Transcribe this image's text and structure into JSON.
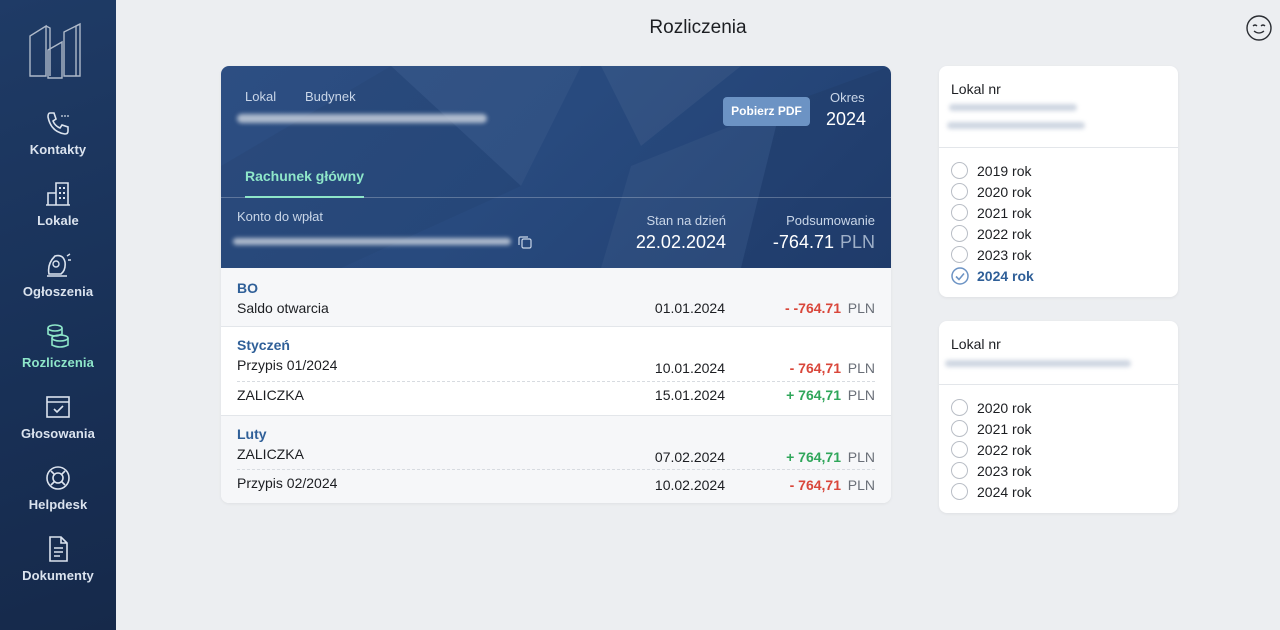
{
  "header": {
    "title": "Rozliczenia"
  },
  "sidebar": {
    "items": [
      {
        "label": "Kontakty"
      },
      {
        "label": "Lokale"
      },
      {
        "label": "Ogłoszenia"
      },
      {
        "label": "Rozliczenia",
        "active": true
      },
      {
        "label": "Głosowania"
      },
      {
        "label": "Helpdesk"
      },
      {
        "label": "Dokumenty"
      }
    ]
  },
  "card": {
    "lokal_label": "Lokal",
    "budynek_label": "Budynek",
    "pdf_button": "Pobierz PDF",
    "okres_label": "Okres",
    "okres_value": "2024",
    "tab_label": "Rachunek główny",
    "konto_label": "Konto do wpłat",
    "stan_label": "Stan na dzień",
    "stan_value": "22.02.2024",
    "summary_label": "Podsumowanie",
    "summary_value": "-764.71",
    "summary_currency": "PLN",
    "sections": [
      {
        "title": "BO",
        "rows": [
          {
            "desc": "Saldo otwarcia",
            "date": "01.01.2024",
            "amount": "- -764.71",
            "currency": "PLN",
            "sign": "neg"
          }
        ]
      },
      {
        "title": "Styczeń",
        "rows": [
          {
            "desc": "Przypis 01/2024",
            "date": "10.01.2024",
            "amount": "- 764,71",
            "currency": "PLN",
            "sign": "neg"
          },
          {
            "desc": "ZALICZKA",
            "date": "15.01.2024",
            "amount": "+ 764,71",
            "currency": "PLN",
            "sign": "pos"
          }
        ]
      },
      {
        "title": "Luty",
        "rows": [
          {
            "desc": "ZALICZKA",
            "date": "07.02.2024",
            "amount": "+ 764,71",
            "currency": "PLN",
            "sign": "pos"
          },
          {
            "desc": "Przypis 02/2024",
            "date": "10.02.2024",
            "amount": "- 764,71",
            "currency": "PLN",
            "sign": "neg"
          }
        ]
      }
    ]
  },
  "panels": [
    {
      "title": "Lokal nr",
      "years": [
        "2019 rok",
        "2020 rok",
        "2021 rok",
        "2022 rok",
        "2023 rok",
        "2024 rok"
      ],
      "selected": "2024 rok"
    },
    {
      "title": "Lokal nr",
      "years": [
        "2020 rok",
        "2021 rok",
        "2022 rok",
        "2023 rok",
        "2024 rok"
      ],
      "selected": ""
    }
  ],
  "colors": {
    "accent": "#8ee6c9",
    "negative": "#d9463a",
    "positive": "#2fa65a",
    "link": "#2f5f98"
  }
}
